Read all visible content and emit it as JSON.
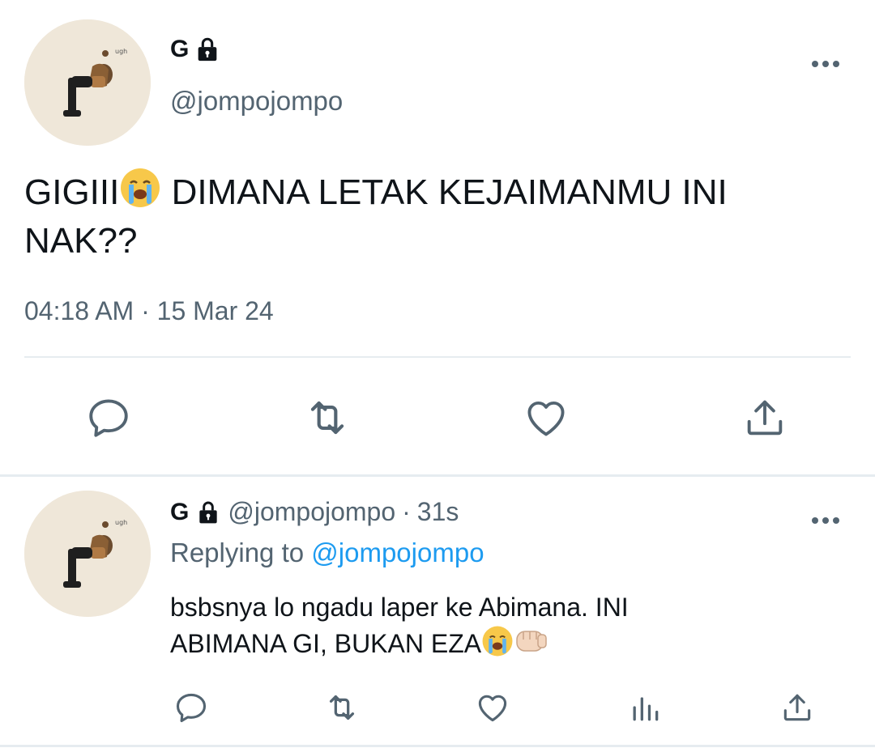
{
  "main_tweet": {
    "display_name": "G",
    "handle": "@jompojompo",
    "text_line1_pre": "GIGIII",
    "text_line1_post": " DIMANA LETAK KEJAIMANMU INI",
    "text_line2": "NAK??",
    "time": "04:18 AM",
    "separator": "·",
    "date": "15 Mar 24",
    "actions": [
      "reply-icon",
      "retweet-icon",
      "like-icon",
      "share-icon"
    ]
  },
  "reply_tweet": {
    "display_name": "G",
    "handle": "@jompojompo",
    "separator": "·",
    "age": "31s",
    "replying_prefix": "Replying to",
    "replying_mention": "@jompojompo",
    "text_line1": "bsbsnya lo ngadu laper ke Abimana. INI",
    "text_line2": "ABIMANA GI, BUKAN EZA",
    "actions": [
      "reply-icon",
      "retweet-icon",
      "like-icon",
      "analytics-icon",
      "share-icon"
    ]
  },
  "colors": {
    "text": "#0f1419",
    "secondary": "#536471",
    "accent": "#1d9bf0",
    "divider": "#e6ecf0",
    "avatar_bg": "#efe7d9"
  },
  "icons": {
    "lock": "lock-icon",
    "more": "more-options-icon",
    "crying": "loudly-crying-face-emoji",
    "fist": "oncoming-fist-emoji"
  }
}
